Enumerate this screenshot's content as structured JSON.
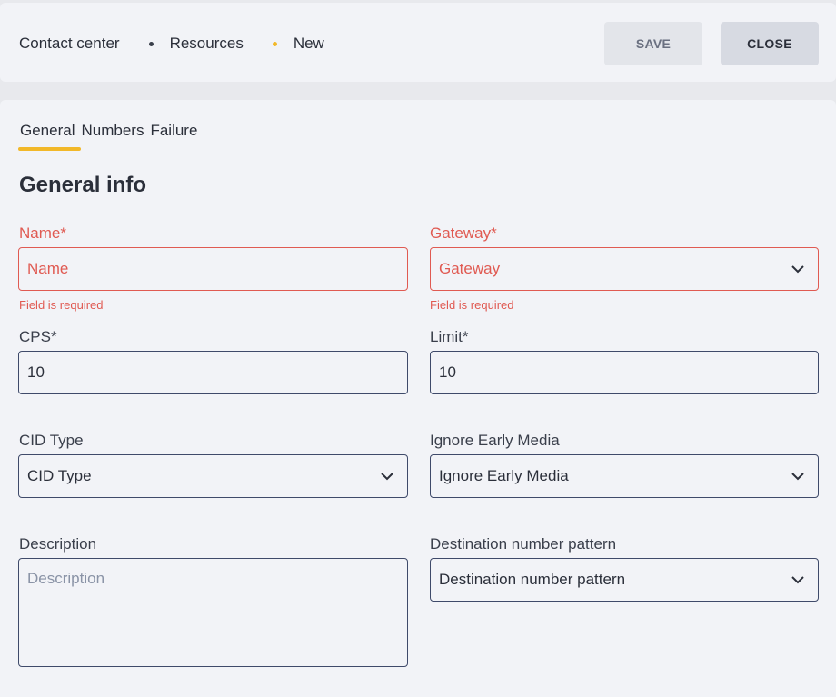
{
  "breadcrumb": [
    "Contact center",
    "Resources",
    "New"
  ],
  "buttons": {
    "save": "SAVE",
    "close": "CLOSE"
  },
  "tabs": [
    "General",
    "Numbers",
    "Failure"
  ],
  "section_title": "General info",
  "fields": {
    "name": {
      "label": "Name*",
      "placeholder": "Name",
      "error": "Field is required"
    },
    "gateway": {
      "label": "Gateway*",
      "placeholder": "Gateway",
      "error": "Field is required"
    },
    "cps": {
      "label": "CPS*",
      "value": "10"
    },
    "limit": {
      "label": "Limit*",
      "value": "10"
    },
    "cid_type": {
      "label": "CID Type",
      "value": "CID Type"
    },
    "ignore_early_media": {
      "label": "Ignore Early Media",
      "value": "Ignore Early Media"
    },
    "description": {
      "label": "Description",
      "placeholder": "Description"
    },
    "destination_pattern": {
      "label": "Destination number pattern",
      "value": "Destination number pattern"
    }
  },
  "colors": {
    "accent": "#f2b829",
    "error": "#e05a52",
    "border": "#3f4a6a"
  }
}
